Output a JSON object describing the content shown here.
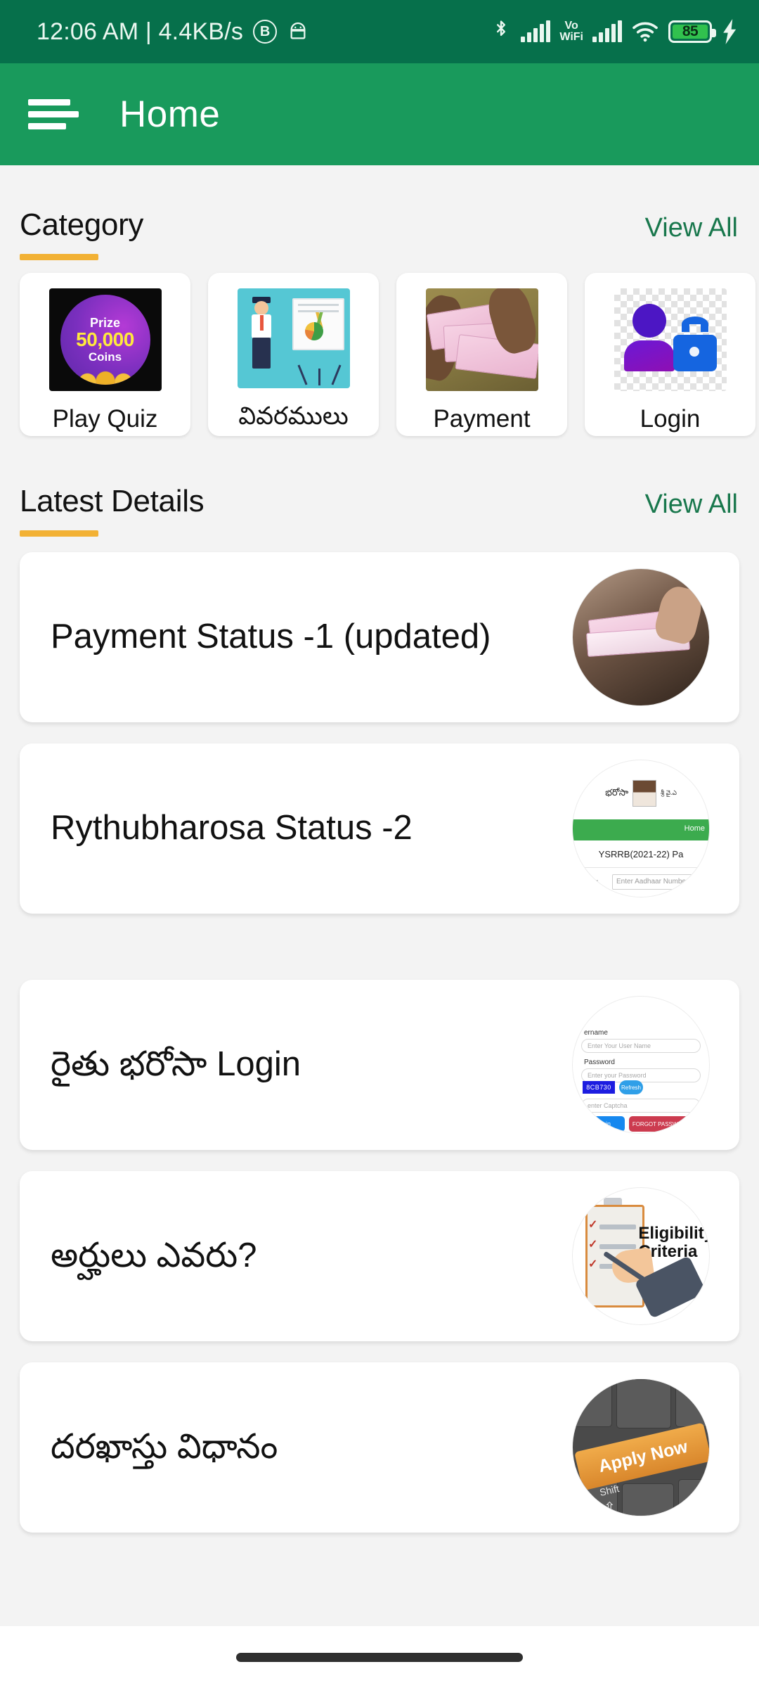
{
  "status_bar": {
    "clock": "12:06 AM | 4.4KB/s",
    "icons": {
      "b_badge": "B",
      "android_icon": "android-icon",
      "bluetooth_icon": "bluetooth-icon",
      "signal_icon": "signal-bars-icon",
      "vowifi_line1": "Vo",
      "vowifi_line2": "WiFi",
      "signal2_icon": "signal-bars-icon",
      "wifi_icon": "wifi-icon",
      "charging_icon": "charging-bolt-icon"
    },
    "battery_level": "85",
    "bg_color": "#06704B"
  },
  "app_bar": {
    "title": "Home",
    "menu_icon": "hamburger-menu-icon",
    "bg_color": "#199A5C"
  },
  "category_section": {
    "title": "Category",
    "view_all": "View All",
    "accent_color": "#F2B134",
    "items": [
      {
        "label": "Play Quiz",
        "art": "quiz-coins-image",
        "art_text": {
          "prize": "Prize",
          "amount": "50,000",
          "coins": "Coins"
        }
      },
      {
        "label": "వివరములు",
        "art": "presentation-illustration"
      },
      {
        "label": "Payment",
        "art": "rupee-notes-photo"
      },
      {
        "label": "Login",
        "art": "user-lock-icon"
      }
    ]
  },
  "latest_details_section": {
    "title": "Latest Details",
    "view_all": "View All",
    "accent_color": "#F2B134",
    "items": [
      {
        "title": "Payment Status -1 (updated)",
        "thumb": "money-in-hand-photo"
      },
      {
        "title": "Rythubharosa Status -2",
        "thumb": "government-portal-screenshot",
        "thumb_text": {
          "nav": "Home",
          "scheme": "YSRRB(2021-22) Pa",
          "field_label": "mber :",
          "field_placeholder": "Enter Aadhaar Number",
          "banner": "భరోసా",
          "cm": "శ్రీ వై.ఎ"
        }
      },
      {
        "title": "రైతు భరోసా Login",
        "thumb": "login-form-screenshot",
        "thumb_text": {
          "username_label": "ername",
          "username_placeholder": "Enter Your User Name",
          "password_label": "Password",
          "password_placeholder": "Enter your Password",
          "captcha": "8CB730",
          "refresh": "Refresh",
          "captcha_placeholder": "enter Captcha",
          "login_button": "Login",
          "forgot_button": "FORGOT PASSWORD"
        }
      },
      {
        "title": "అర్హులు ఎవరు?",
        "thumb": "eligibility-criteria-illustration",
        "thumb_text": {
          "line1": "Eligibility",
          "line2": "Criteria"
        }
      },
      {
        "title": "దరఖాస్తు విధానం",
        "thumb": "apply-now-keyboard-photo",
        "thumb_text": {
          "key": "Apply Now",
          "shift": "Shift"
        }
      }
    ]
  },
  "nav_bar": {
    "gesture_handle": "gesture-handle"
  },
  "page_bg_color": "#F3F3F3"
}
